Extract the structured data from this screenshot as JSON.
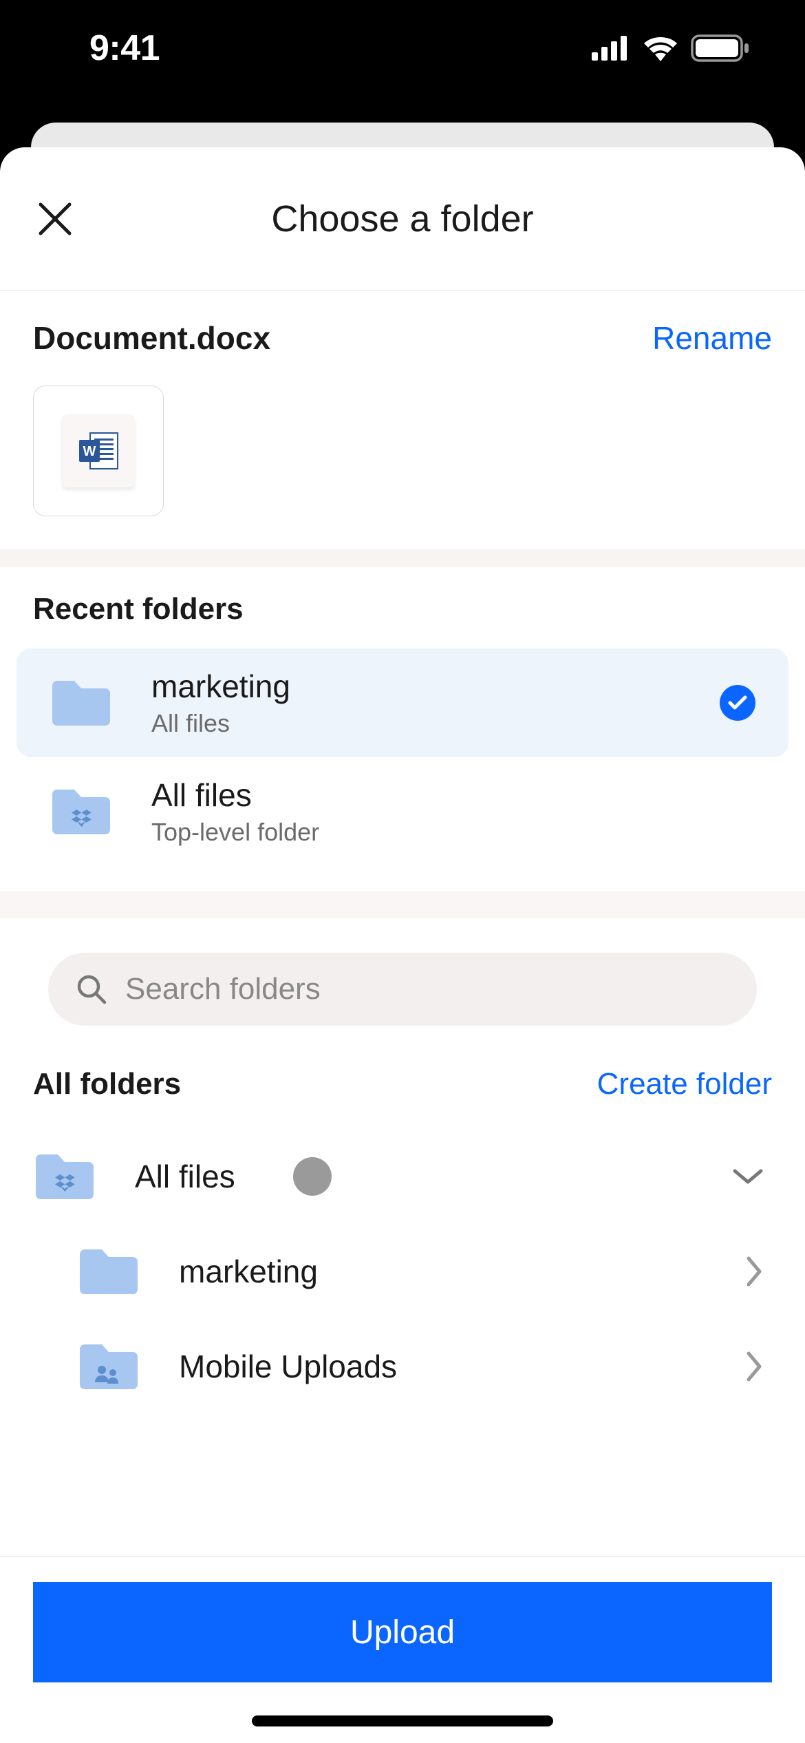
{
  "status": {
    "time": "9:41"
  },
  "sheet": {
    "title": "Choose a folder",
    "file_name": "Document.docx",
    "rename_label": "Rename"
  },
  "recent": {
    "title": "Recent folders",
    "items": [
      {
        "name": "marketing",
        "sub": "All files",
        "selected": true,
        "icon": "folder"
      },
      {
        "name": "All files",
        "sub": "Top-level folder",
        "selected": false,
        "icon": "dropbox-folder"
      }
    ]
  },
  "search": {
    "placeholder": "Search folders"
  },
  "all_folders": {
    "title": "All folders",
    "create_label": "Create folder",
    "tree": [
      {
        "name": "All files",
        "icon": "dropbox-folder",
        "expandable": "down",
        "loading": true,
        "depth": 0
      },
      {
        "name": "marketing",
        "icon": "folder",
        "expandable": "right",
        "depth": 1
      },
      {
        "name": "Mobile Uploads",
        "icon": "shared-folder",
        "expandable": "right",
        "depth": 1
      }
    ]
  },
  "footer": {
    "upload_label": "Upload"
  }
}
